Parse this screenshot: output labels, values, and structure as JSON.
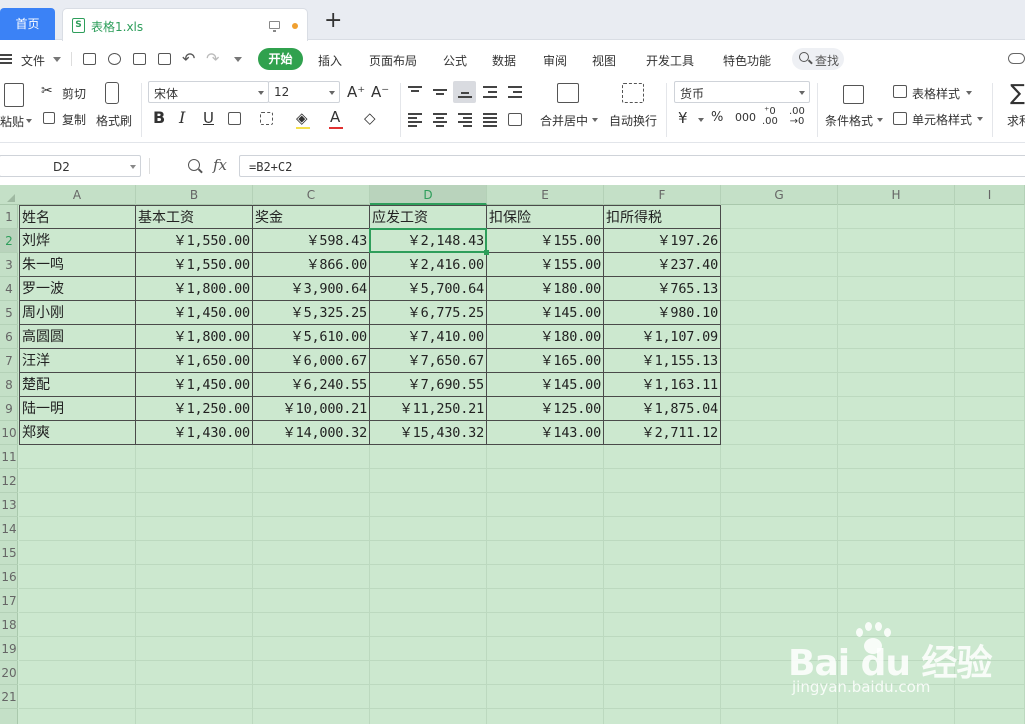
{
  "tabs": {
    "home": "首页",
    "file": "表格1.xls",
    "xls_icon": "S"
  },
  "menu": {
    "file": "文件",
    "items": [
      "开始",
      "插入",
      "页面布局",
      "公式",
      "数据",
      "审阅",
      "视图",
      "开发工具",
      "特色功能"
    ],
    "search": "查找"
  },
  "ribbon": {
    "paste": "粘贴",
    "cut": "剪切",
    "copy": "复制",
    "format_painter": "格式刷",
    "font_name": "宋体",
    "font_size": "12",
    "merge_center": "合并居中",
    "wrap_text": "自动换行",
    "number_format": "货币",
    "currency_symbol": "¥",
    "percent_symbol": "%",
    "thousands": "000",
    "cond_format": "条件格式",
    "table_style": "表格样式",
    "cell_style": "单元格样式",
    "sum": "求和"
  },
  "formula_bar": {
    "cell_ref": "D2",
    "fx": "fx",
    "formula": "=B2+C2"
  },
  "sheet": {
    "columns": [
      "A",
      "B",
      "C",
      "D",
      "E",
      "F",
      "G",
      "H",
      "I"
    ],
    "selected_column": "D",
    "selected_row": 2,
    "rows": [
      "1",
      "2",
      "3",
      "4",
      "5",
      "6",
      "7",
      "8",
      "9",
      "10",
      "11",
      "12",
      "13",
      "14",
      "15",
      "16",
      "17",
      "18",
      "19",
      "20",
      "21"
    ],
    "header": [
      "姓名",
      "基本工资",
      "奖金",
      "应发工资",
      "扣保险",
      "扣所得税"
    ],
    "data": [
      [
        "刘烨",
        "￥1,550.00",
        "￥598.43",
        "￥2,148.43",
        "￥155.00",
        "￥197.26"
      ],
      [
        "朱一鸣",
        "￥1,550.00",
        "￥866.00",
        "￥2,416.00",
        "￥155.00",
        "￥237.40"
      ],
      [
        "罗一波",
        "￥1,800.00",
        "￥3,900.64",
        "￥5,700.64",
        "￥180.00",
        "￥765.13"
      ],
      [
        "周小刚",
        "￥1,450.00",
        "￥5,325.25",
        "￥6,775.25",
        "￥145.00",
        "￥980.10"
      ],
      [
        "高圆圆",
        "￥1,800.00",
        "￥5,610.00",
        "￥7,410.00",
        "￥180.00",
        "￥1,107.09"
      ],
      [
        "汪洋",
        "￥1,650.00",
        "￥6,000.67",
        "￥7,650.67",
        "￥165.00",
        "￥1,155.13"
      ],
      [
        "楚配",
        "￥1,450.00",
        "￥6,240.55",
        "￥7,690.55",
        "￥145.00",
        "￥1,163.11"
      ],
      [
        "陆一明",
        "￥1,250.00",
        "￥10,000.21",
        "￥11,250.21",
        "￥125.00",
        "￥1,875.04"
      ],
      [
        "郑爽",
        "￥1,430.00",
        "￥14,000.32",
        "￥15,430.32",
        "￥143.00",
        "￥2,711.12"
      ]
    ]
  },
  "watermark": {
    "brand": "Bai du 经验",
    "url": "jingyan.baidu.com"
  },
  "colors": {
    "accent": "#30a14e",
    "home_tab": "#3b82f6",
    "sheet_bg": "#cce8cf"
  }
}
